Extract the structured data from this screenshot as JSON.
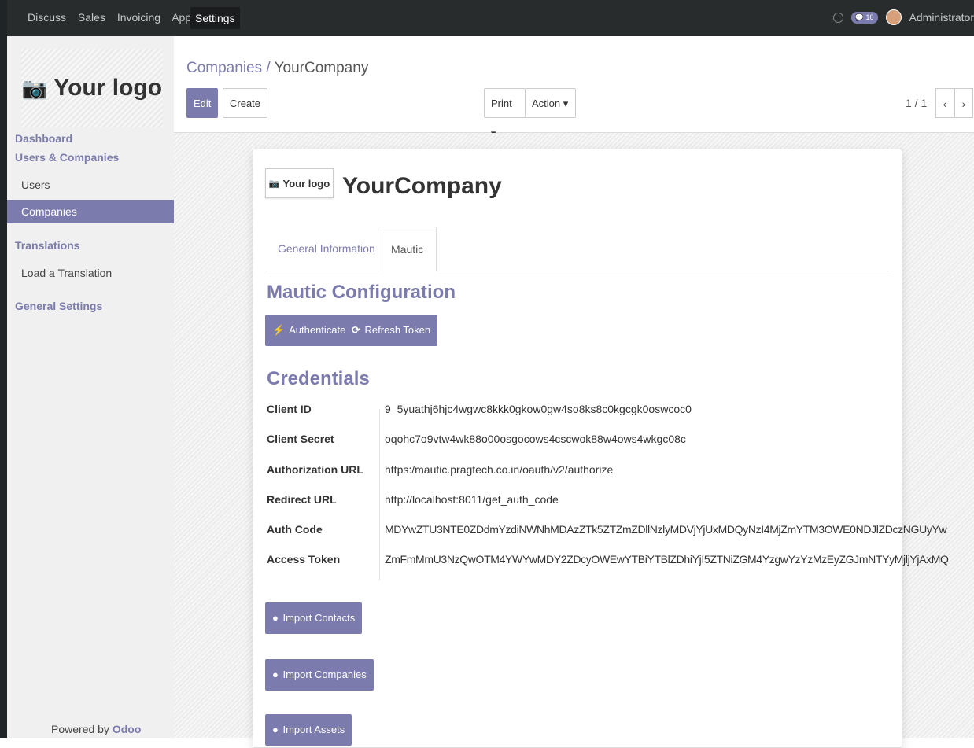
{
  "topbar": {
    "menu": [
      "Discuss",
      "Sales",
      "Invoicing",
      "Apps"
    ],
    "active_menu": "Settings",
    "message_count": "10",
    "user": "Administrator"
  },
  "sidebar": {
    "logo_text": "Your logo",
    "sections": [
      {
        "label": "Dashboard"
      },
      {
        "label": "Users & Companies"
      },
      {
        "label": "Translations"
      },
      {
        "label": "General Settings"
      }
    ],
    "items": [
      {
        "label": "Users"
      },
      {
        "label": "Companies"
      },
      {
        "label": "Load a Translation"
      }
    ],
    "powered_prefix": "Powered by",
    "powered_brand": "Odoo"
  },
  "control": {
    "breadcrumb_parent": "Companies",
    "breadcrumb_sep": "/",
    "breadcrumb_current": "YourCompany",
    "edit_label": "Edit",
    "create_label": "Create",
    "print_label": "Print",
    "action_label": "Action",
    "pager": "1 / 1"
  },
  "form": {
    "logo_text": "Your logo",
    "company_name": "YourCompany",
    "tabs": [
      {
        "label": "General Information"
      },
      {
        "label": "Mautic"
      }
    ],
    "config_title": "Mautic Configuration",
    "authenticate_label": "Authenticate",
    "refresh_label": "Refresh Token",
    "credentials_title": "Credentials",
    "fields": [
      {
        "label": "Client ID",
        "value": "9_5yuathj6hjc4wgwc8kkk0gkow0gw4so8ks8c0kgcgk0oswcoc0"
      },
      {
        "label": "Client Secret",
        "value": "oqohc7o9vtw4wk88o00osgocows4cscwok88w4ows4wkgc08c"
      },
      {
        "label": "Authorization URL",
        "value": "https:/mautic.pragtech.co.in/oauth/v2/authorize"
      },
      {
        "label": "Redirect URL",
        "value": "http://localhost:8011/get_auth_code"
      },
      {
        "label": "Auth Code",
        "value": "MDYwZTU3NTE0ZDdmYzdiNWNhMDAzZTk5ZTZmZDllNzlyMDVjYjUxMDQyNzI4MjZmYTM3OWE0NDJlZDczNGUyYw"
      },
      {
        "label": "Access Token",
        "value": "ZmFmMmU3NzQwOTM4YWYwMDY2ZDcyOWEwYTBiYTBlZDhiYjI5ZTNiZGM4YzgwYzYzMzEyZGJmNTYyMjljYjAxMQ"
      }
    ],
    "import_contacts": "Import Contacts",
    "import_companies": "Import Companies",
    "import_assets": "Import Assets"
  }
}
